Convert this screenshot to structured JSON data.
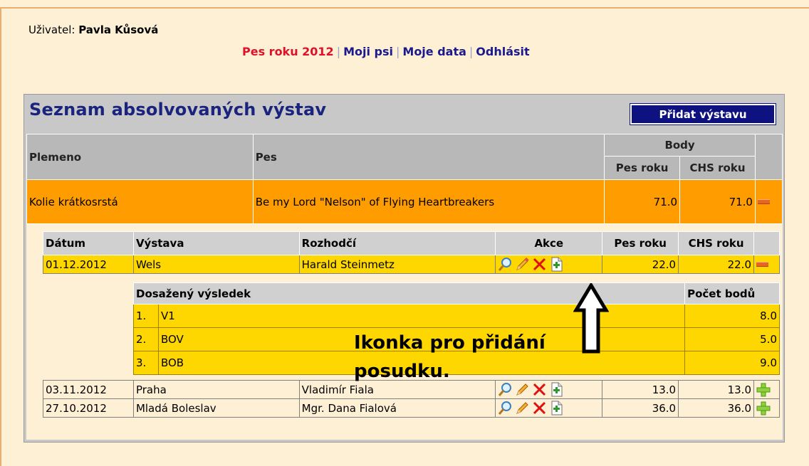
{
  "user": {
    "label": "Uživatel:",
    "name": "Pavla Kůsová"
  },
  "nav": [
    {
      "label": "Pes roku 2012",
      "active": true
    },
    {
      "label": "Moji psi",
      "active": false
    },
    {
      "label": "Moje data",
      "active": false
    },
    {
      "label": "Odhlásit",
      "active": false
    }
  ],
  "panel": {
    "title": "Seznam absolvovaných výstav",
    "add_button": "Přidat výstavu"
  },
  "main_table": {
    "headers": {
      "breed": "Plemeno",
      "dog": "Pes",
      "points": "Body",
      "dog_year": "Pes roku",
      "chs_year": "CHS roku"
    },
    "dog_row": {
      "breed": "Kolie krátkosrstá",
      "dog": "Be my Lord \"Nelson\" of Flying Heartbreakers",
      "dog_year": "71.0",
      "chs_year": "71.0"
    }
  },
  "shows_table": {
    "headers": {
      "date": "Dátum",
      "show": "Výstava",
      "judge": "Rozhodčí",
      "actions": "Akce",
      "dog_year": "Pes roku",
      "chs_year": "CHS roku"
    },
    "rows": [
      {
        "date": "01.12.2012",
        "show": "Wels",
        "judge": "Harald Steinmetz",
        "dog_year": "22.0",
        "chs_year": "22.0"
      },
      {
        "date": "03.11.2012",
        "show": "Praha",
        "judge": "Vladimír Fiala",
        "dog_year": "13.0",
        "chs_year": "13.0"
      },
      {
        "date": "27.10.2012",
        "show": "Mladá Boleslav",
        "judge": "Mgr. Dana Fialová",
        "dog_year": "36.0",
        "chs_year": "36.0"
      }
    ]
  },
  "results_table": {
    "headers": {
      "result": "Dosažený výsledek",
      "points": "Počet bodů"
    },
    "rows": [
      {
        "n": "1.",
        "result": "V1",
        "points": "8.0"
      },
      {
        "n": "2.",
        "result": "BOV",
        "points": "5.0"
      },
      {
        "n": "3.",
        "result": "BOB",
        "points": "9.0"
      }
    ]
  },
  "annotation": {
    "line1": "Ikonka pro přidání",
    "line2": "posudku."
  },
  "colors": {
    "accent": "#0d1280",
    "dog_row": "#ff9d00",
    "show_row": "#ffd700",
    "nav_active": "#e0102a"
  }
}
